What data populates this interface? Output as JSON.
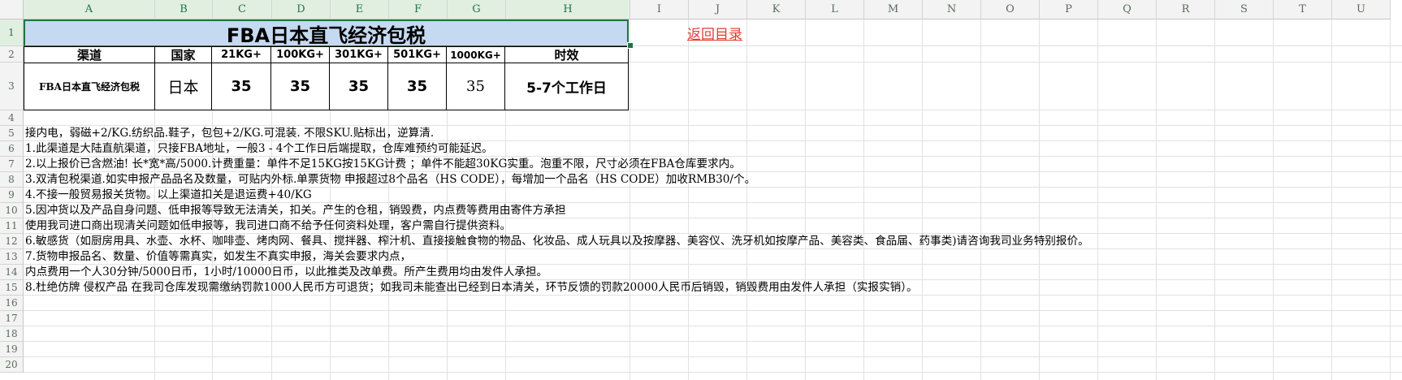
{
  "sheet": {
    "columns": [
      "A",
      "B",
      "C",
      "D",
      "E",
      "F",
      "G",
      "H",
      "I",
      "J",
      "K",
      "L",
      "M",
      "N",
      "O",
      "P",
      "Q",
      "R",
      "S",
      "T",
      "U"
    ],
    "rows": [
      "1",
      "2",
      "3",
      "4",
      "5",
      "6",
      "7",
      "8",
      "9",
      "10",
      "11",
      "12",
      "13",
      "14",
      "15",
      "16",
      "17",
      "18",
      "19",
      "20"
    ]
  },
  "table": {
    "title": "FBA日本直飞经济包税",
    "headers": [
      "渠道",
      "国家",
      "21KG+",
      "100KG+",
      "301KG+",
      "501KG+",
      "1000KG+",
      "时效"
    ],
    "row": {
      "channel": "FBA日本直飞经济包税",
      "country": "日本",
      "p21": "35",
      "p100": "35",
      "p301": "35",
      "p501": "35",
      "p1000": "35",
      "timing": "5-7个工作日"
    }
  },
  "link": {
    "back": "返回目录"
  },
  "notes": [
    "接内电，弱磁+2/KG.纺织品.鞋子，包包+2/KG.可混装. 不限SKU.贴标出，逆算清.",
    "1.此渠道是大陆直航渠道，只接FBA地址，一般3 - 4个工作日后端提取，仓库难预约可能延迟。",
    "2.以上报价已含燃油! 长*宽*高/5000.计费重量：单件不足15KG按15KG计费 ；单件不能超30KG实重。泡重不限，尺寸必须在FBA仓库要求内。",
    "3.双清包税渠道.如实申报产品品名及数量，可贴内外标.单票货物 申报超过8个品名（HS CODE），每增加一个品名（HS CODE）加收RMB30/个。",
    "4.不接一般贸易报关货物。以上渠道扣关是退运费+40/KG",
    "5.因冲货以及产品自身问题、低申报等导致无法清关，扣关。产生的仓租，销毁费，内点费等费用由寄件方承担",
    "使用我司进口商出现清关问题如低申报等，我司进口商不给予任何资料处理，客户需自行提供资料。",
    "6.敏感货（如厨房用具、水壶、水杯、咖啡壶、烤肉网、餐具、搅拌器、榨汁机、直接接触食物的物品、化妆品、成人玩具以及按摩器、美容仪、洗牙机如按摩产品、美容类、食品届、药事类)请咨询我司业务特别报价。",
    "7.货物申报品名、数量、价值等需真实，如发生不真实申报，海关会要求内点，",
    "内点费用一个人30分钟/5000日币，1小时/10000日币，以此推类及改单费。所产生费用均由发件人承担。",
    "8.杜绝仿牌 侵权产品 在我司仓库发现需缴纳罚款1000人民币方可退货；如我司未能查出已经到日本清关，环节反馈的罚款20000人民币后销毁，销毁费用由发件人承担（实报实销）。"
  ]
}
